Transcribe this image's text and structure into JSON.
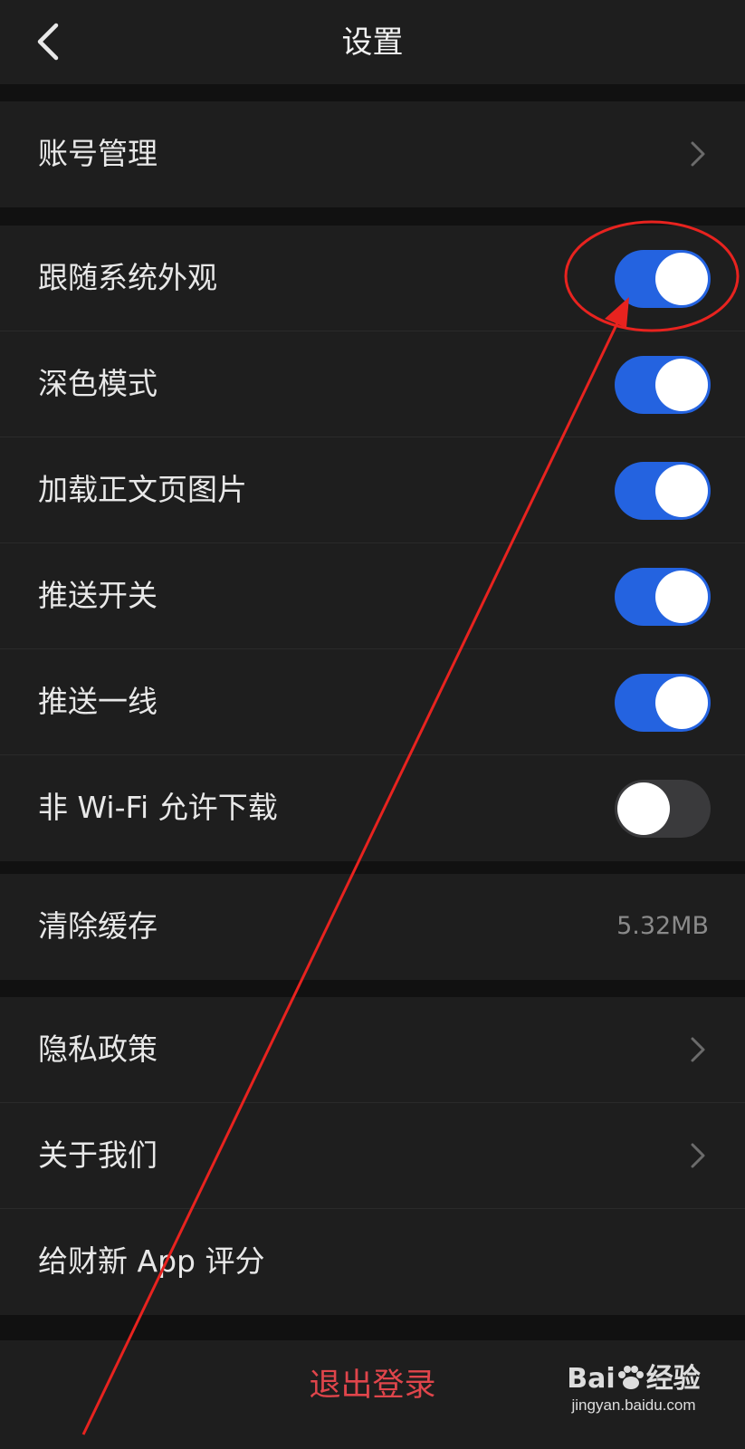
{
  "header": {
    "title": "设置",
    "back_icon": "chevron-left-icon"
  },
  "groups": [
    {
      "items": [
        {
          "label": "账号管理",
          "accessory": "chevron-right-icon"
        }
      ]
    },
    {
      "items": [
        {
          "label": "跟随系统外观",
          "toggle": true
        },
        {
          "label": "深色模式",
          "toggle": true
        },
        {
          "label": "加载正文页图片",
          "toggle": true
        },
        {
          "label": "推送开关",
          "toggle": true
        },
        {
          "label": "推送一线",
          "toggle": true
        },
        {
          "label": "非 Wi-Fi 允许下载",
          "toggle": false
        }
      ]
    },
    {
      "items": [
        {
          "label": "清除缓存",
          "value": "5.32MB"
        }
      ]
    },
    {
      "items": [
        {
          "label": "隐私政策",
          "accessory": "chevron-right-icon"
        },
        {
          "label": "关于我们",
          "accessory": "chevron-right-icon"
        },
        {
          "label": "给财新 App 评分"
        }
      ]
    }
  ],
  "footer": {
    "logout_label": "退出登录"
  },
  "watermark": {
    "brand_left": "Bai",
    "brand_right": "经验",
    "url": "jingyan.baidu.com"
  },
  "colors": {
    "background": "#111111",
    "surface": "#1e1e1e",
    "toggle_on": "#2463e0",
    "toggle_off": "#3a3a3c",
    "logout": "#e0454b",
    "annotation": "#e8231f"
  }
}
